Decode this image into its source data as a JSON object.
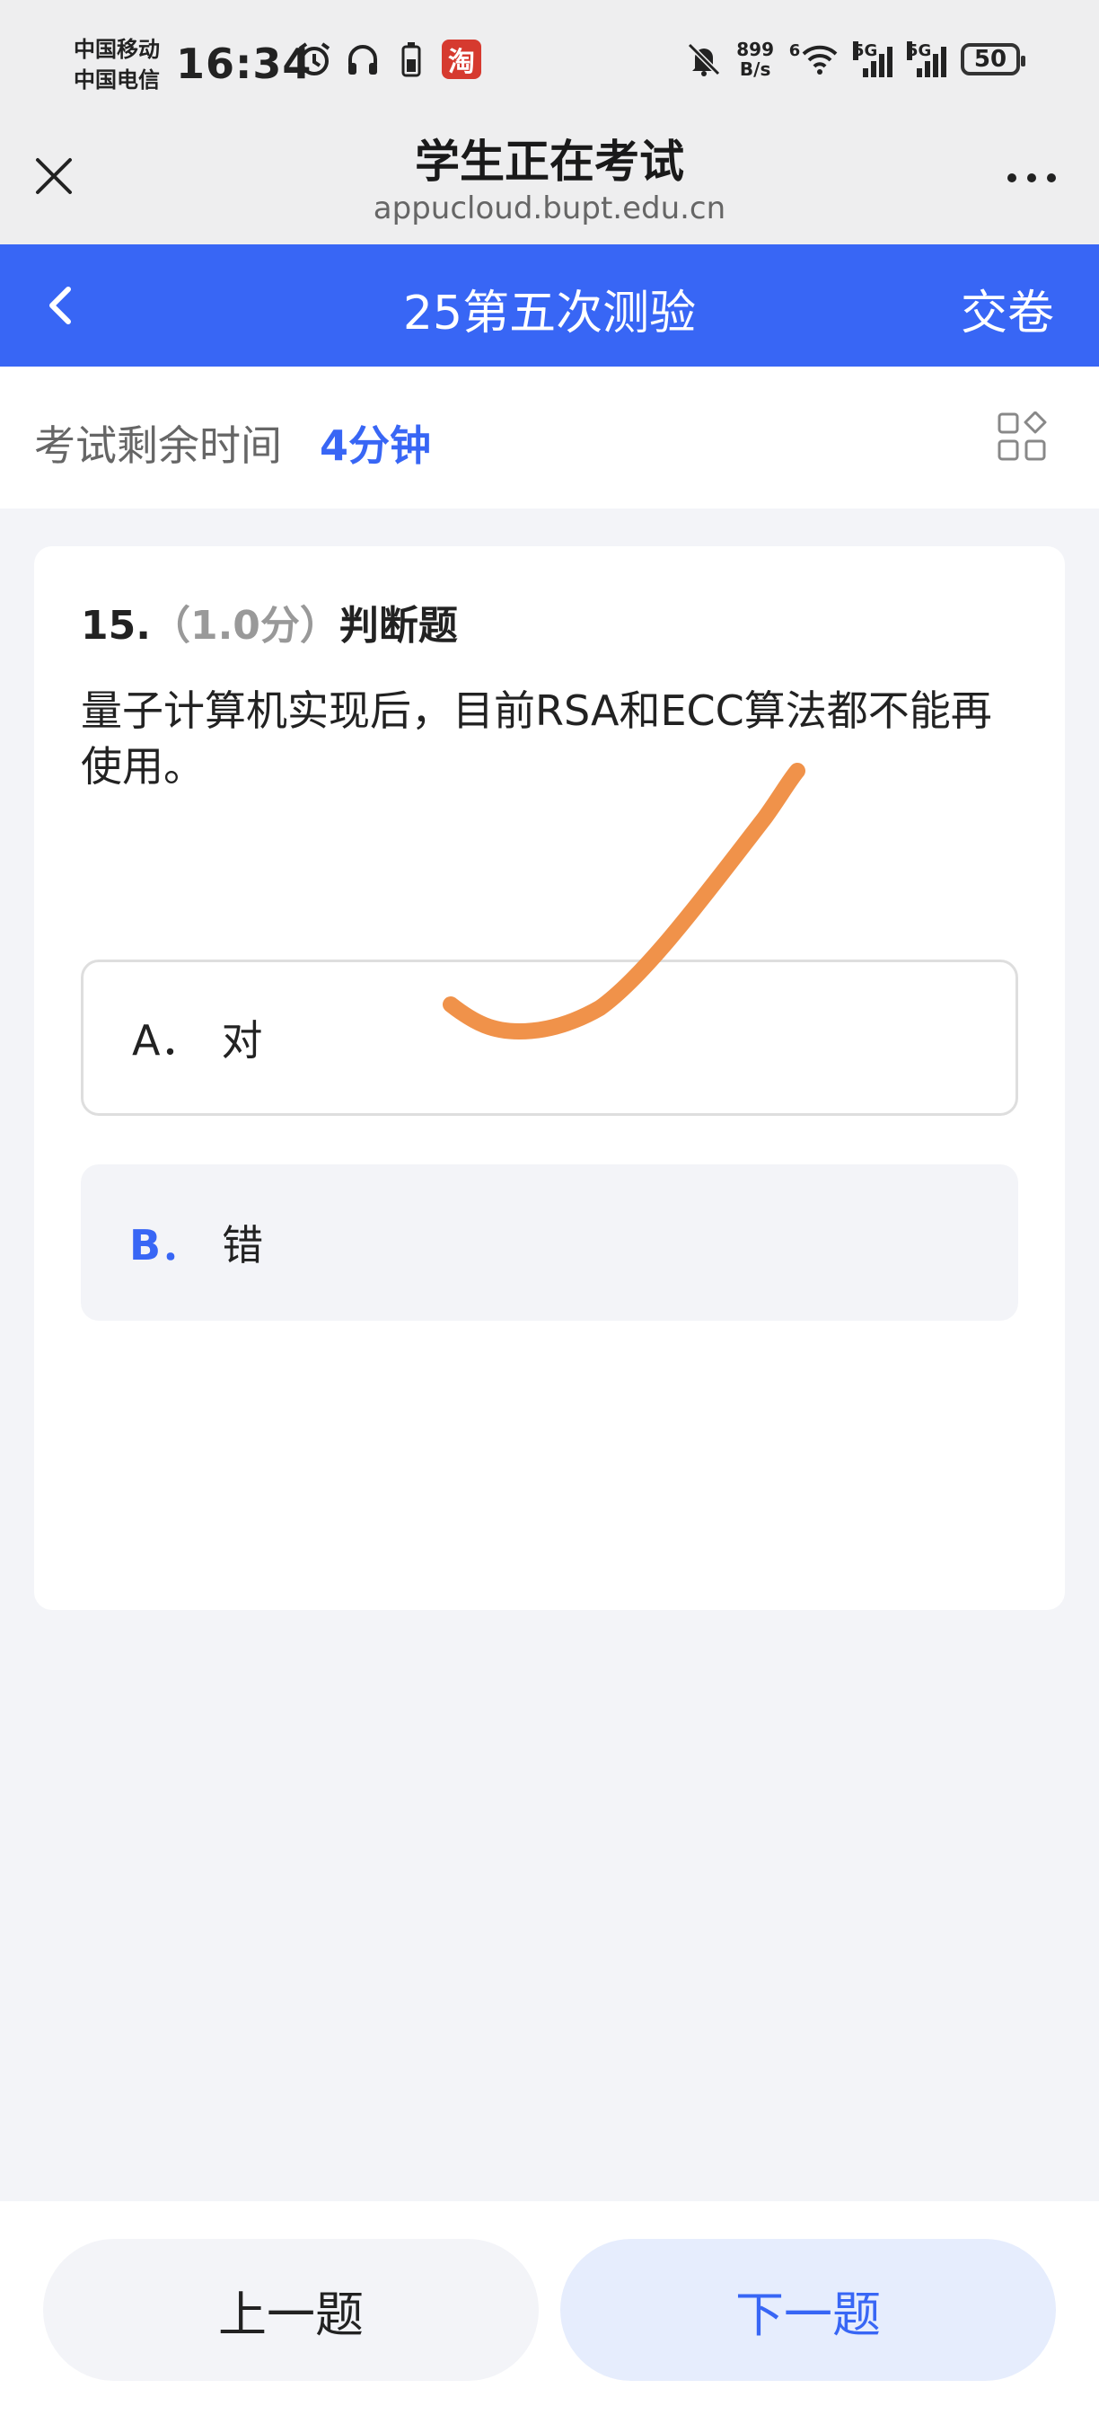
{
  "status_bar": {
    "carrier_1": "中国移动",
    "carrier_2": "中国电信",
    "time": "16:34",
    "taobao_icon_text": "淘",
    "net_speed_value": "899",
    "net_speed_unit": "B/s",
    "wifi_badge": "6",
    "signal_1_label": "5G",
    "signal_2_label": "5G",
    "battery": "50",
    "icons": [
      "alarm-icon",
      "headphones-icon",
      "battery-small-icon",
      "taobao-icon",
      "mute-bell-icon",
      "wifi-icon",
      "signal-icon",
      "battery-icon"
    ]
  },
  "browser": {
    "title": "学生正在考试",
    "url": "appucloud.bupt.edu.cn",
    "close_icon": "close-icon",
    "more_icon": "more-icon"
  },
  "appbar": {
    "title": "25第五次测验",
    "submit_label": "交卷",
    "back_icon": "chevron-left-icon"
  },
  "timer": {
    "label": "考试剩余时间",
    "value": "4分钟",
    "grid_icon": "question-grid-icon"
  },
  "question": {
    "number": "15.",
    "score": "（1.0分）",
    "type": "判断题",
    "text": "量子计算机实现后，目前RSA和ECC算法都不能再使用。",
    "options": [
      {
        "letter": "A．",
        "text": "对"
      },
      {
        "letter": "B．",
        "text": "错"
      }
    ]
  },
  "navigation": {
    "prev_label": "上一题",
    "next_label": "下一题"
  },
  "colors": {
    "brand_blue": "#3866f5",
    "annotation_orange": "#f0924a"
  }
}
